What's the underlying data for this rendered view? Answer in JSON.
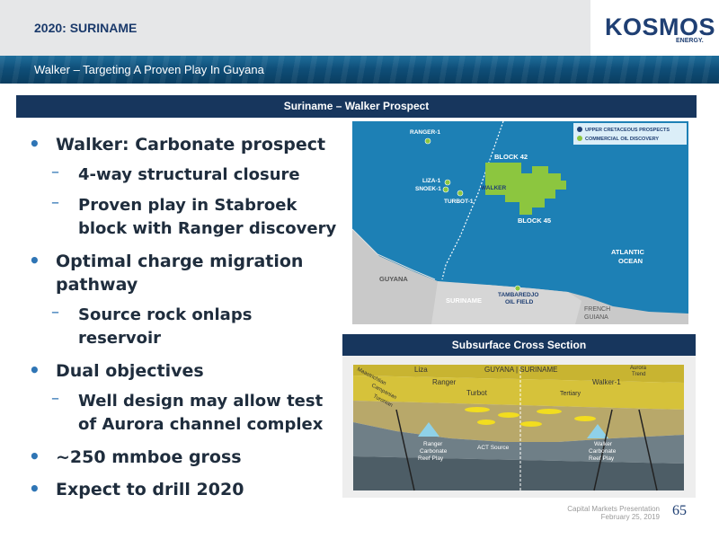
{
  "header": {
    "deck_label": "2020: SURINAME",
    "subtitle": "Walker – Targeting A Proven Play In Guyana",
    "logo_text": "KOSMOS",
    "logo_sub": "ENERGY."
  },
  "panel": {
    "title": "Suriname – Walker Prospect"
  },
  "bullets": [
    {
      "level": 1,
      "text": "Walker: Carbonate prospect"
    },
    {
      "level": 2,
      "text": "4-way structural closure"
    },
    {
      "level": 2,
      "text": "Proven play in Stabroek block with Ranger discovery"
    },
    {
      "level": 1,
      "text": "Optimal charge migration pathway"
    },
    {
      "level": 2,
      "text": "Source rock onlaps reservoir"
    },
    {
      "level": 1,
      "text": "Dual objectives"
    },
    {
      "level": 2,
      "text": "Well design may allow test of Aurora channel complex"
    },
    {
      "level": 1,
      "text": "~250 mmboe gross"
    },
    {
      "level": 1,
      "text": "Expect to drill 2020"
    }
  ],
  "map": {
    "legend": {
      "upper_cretaceous": "UPPER CRETACEOUS PROSPECTS",
      "commercial_oil": "COMMERCIAL OIL DISCOVERY"
    },
    "labels": {
      "ranger": "RANGER-1",
      "liza": "LIZA-1",
      "snoek": "SNOEK-1",
      "turbot": "TURBOT-1",
      "block42": "BLOCK 42",
      "walker": "WALKER",
      "block45": "BLOCK 45",
      "atlantic1": "ATLANTIC",
      "atlantic2": "OCEAN",
      "guyana": "GUYANA",
      "suriname": "SURINAME",
      "tambaredjo1": "TAMBAREDJO",
      "tambaredjo2": "OIL FIELD",
      "french1": "FRENCH",
      "french2": "GUIANA"
    },
    "colors": {
      "ocean": "#1d80b5",
      "land": "#c9c9c9",
      "block": "#8cc63f",
      "legend_blue": "#1f3f73"
    }
  },
  "cross_section": {
    "title": "Subsurface Cross Section",
    "labels": {
      "maastrichtian": "Maastrichtian",
      "campanian": "Campanian",
      "turonian": "Turonian",
      "liza": "Liza",
      "ranger": "Ranger",
      "guyana_suriname": "GUYANA   |   SURINAME",
      "aurora1": "Aurora",
      "aurora2": "Trend",
      "walker1": "Walker-1",
      "turbot": "Turbot",
      "tertiary": "Tertiary",
      "rcrp1": "Ranger",
      "rcrp2": "Carbonate",
      "rcrp3": "Reef Play",
      "act": "ACT Source",
      "wcrp1": "Walker",
      "wcrp2": "Carbonate",
      "wcrp3": "Reef Play"
    }
  },
  "footer": {
    "line1": "Capital Markets Presentation",
    "line2": "February 25, 2019",
    "page": "65"
  }
}
